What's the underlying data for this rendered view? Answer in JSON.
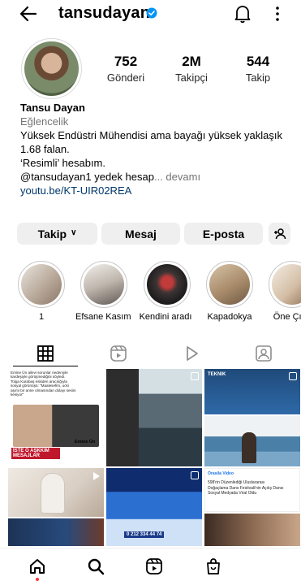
{
  "header": {
    "username": "tansudayan",
    "icons": [
      "back-arrow-icon",
      "verified-badge-icon",
      "notification-bell-icon",
      "more-vertical-icon"
    ],
    "verified_color": "#0095f6"
  },
  "stats": {
    "posts": {
      "value": "752",
      "label": "Gönderi"
    },
    "followers": {
      "value": "2M",
      "label": "Takipçi"
    },
    "following": {
      "value": "544",
      "label": "Takip"
    }
  },
  "bio": {
    "name": "Tansu Dayan",
    "category": "Eğlencelik",
    "line1": "Yüksek Endüstri Mühendisi ama bayağı yüksek yaklaşık",
    "line2": "1.68 falan.",
    "line3": "‘Resimli’ hesabım.",
    "line4_text": "@tansudayan1 yedek hesap",
    "line4_more": "... devamı",
    "link": "youtu.be/KT-UIR02REA",
    "link_color": "#00376b"
  },
  "actions": {
    "follow": "Takip",
    "message": "Mesaj",
    "email": "E-posta",
    "suggest_icon": "add-person-icon"
  },
  "highlights": [
    {
      "label": "1"
    },
    {
      "label": "Efsane Kasım"
    },
    {
      "label": "Kendini aradı"
    },
    {
      "label": "Kapadokya"
    },
    {
      "label": "Öne Çıka"
    }
  ],
  "tabs": [
    "grid-icon",
    "reels-icon",
    "play-icon",
    "tagged-icon"
  ],
  "grid": {
    "tile1": {
      "line1": "Emine Ün ailevi sorunlar nedeniyle",
      "line2": "kardeşiyle görüşmediğini söyledi.",
      "line3": "Tolga Karabaş eskiden aracılığıyla",
      "line4": "sosyal görünüşü: \"Maalesefim, ucki",
      "line5": "aşımi bir anne olmasından dolayı sesini",
      "line6": "kesiyor\"",
      "banner": "İSTE O AŞKKIM MESAJLAR",
      "name_tag": "Emine Ün"
    },
    "tile3": {
      "tag": "TEKNIK"
    },
    "tile6": {
      "header": "Orasila Video",
      "text1": "598'rin Düzenlediği Uluslararası",
      "text2": "Doğaçlama Dans Festivali'nin Açılış Dansı",
      "text3": "Sosyal Medyada Viral Oldu"
    },
    "tile5": {
      "score": "0 212 334 44 74"
    }
  },
  "bottom_nav": [
    "home-icon",
    "search-icon",
    "reels-icon",
    "shop-icon"
  ],
  "accent_red": "#ff3040"
}
